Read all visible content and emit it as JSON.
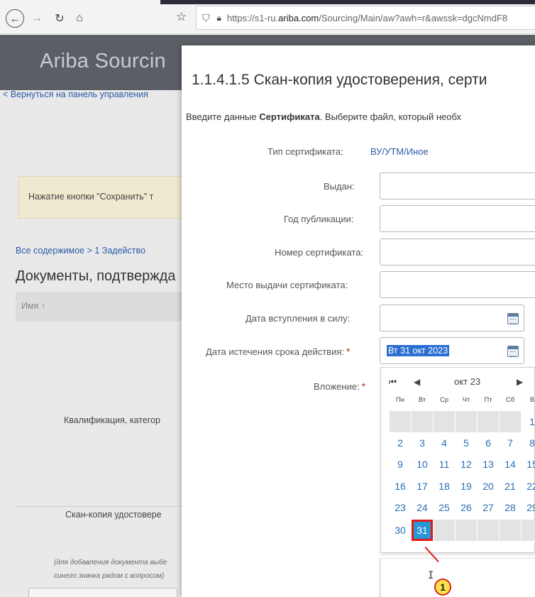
{
  "browser": {
    "url_prefix": "https://s1-ru.",
    "url_domain": "ariba.com",
    "url_suffix": "/Sourcing/Main/aw?awh=r&awssk=dgcNmdF8"
  },
  "background": {
    "app_title": "Ariba Sourcin",
    "back_link": "< Вернуться на панель управления",
    "notice": "Нажатие кнопки \"Сохранить\" т",
    "breadcrumb": "Все содержимое > 1 Задейство",
    "heading": "Документы, подтвержда",
    "col_name": "Имя ↑",
    "qual_row": "Квалификация, категор",
    "scan_row_title": "Скан-копия удостовере",
    "scan_note_1": "(для добавления документа выбе",
    "scan_note_2": "синего значка рядом с вопросом)"
  },
  "modal": {
    "title": "1.1.4.1.5 Скан-копия удостоверения, серти",
    "desc_pre": "Введите данные ",
    "desc_bold": "Сертификата",
    "desc_post": ". Выберите файл, который необх",
    "fields": {
      "cert_type_label": "Тип сертификата:",
      "cert_type_value": "ВУ/УТМ/Иное",
      "issued_label": "Выдан:",
      "year_label": "Год публикации:",
      "number_label": "Номер сертификата:",
      "place_label": "Место выдачи сертификата:",
      "effective_label": "Дата вступления в силу:",
      "expiry_label": "Дата истечения срока действия:",
      "expiry_value": "Вт 31 окт 2023",
      "attachment_label": "Вложение:"
    }
  },
  "calendar": {
    "month_label": "окт 23",
    "first_btn": "⏮",
    "prev_btn": "◀",
    "next_btn": "▶",
    "weekdays": [
      "Пн",
      "Вт",
      "Ср",
      "Чт",
      "Пт",
      "Сб",
      "В"
    ],
    "weeks": [
      [
        "",
        "",
        "",
        "",
        "",
        "",
        "1"
      ],
      [
        "2",
        "3",
        "4",
        "5",
        "6",
        "7",
        "8"
      ],
      [
        "9",
        "10",
        "11",
        "12",
        "13",
        "14",
        "15"
      ],
      [
        "16",
        "17",
        "18",
        "19",
        "20",
        "21",
        "22"
      ],
      [
        "23",
        "24",
        "25",
        "26",
        "27",
        "28",
        "29"
      ],
      [
        "30",
        "31",
        "",
        "",
        "",
        "",
        ""
      ]
    ],
    "selected_day": "31"
  },
  "callout": {
    "number": "1"
  },
  "colors": {
    "link": "#2b5aa8",
    "selected_day_bg": "#2a96d6",
    "highlight_red": "#e01b1b",
    "required": "#d0261a"
  }
}
